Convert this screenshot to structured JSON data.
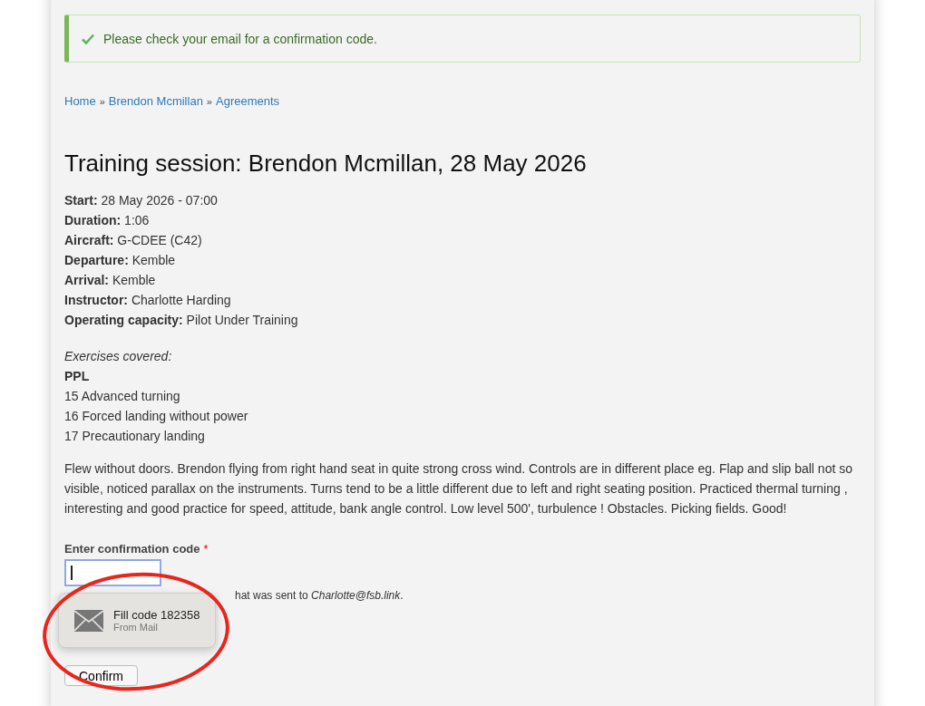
{
  "alert": {
    "kind": "success",
    "message": "Please check your email for a confirmation code."
  },
  "breadcrumb": [
    {
      "label": "Home"
    },
    {
      "label": "Brendon Mcmillan"
    },
    {
      "label": "Agreements"
    }
  ],
  "breadcrumb_separator": "»",
  "title": "Training session: Brendon Mcmillan, 28 May 2026",
  "details": [
    {
      "label": "Start:",
      "value": "28 May 2026 - 07:00"
    },
    {
      "label": "Duration:",
      "value": "1:06"
    },
    {
      "label": "Aircraft:",
      "value": "G-CDEE (C42)"
    },
    {
      "label": "Departure:",
      "value": "Kemble"
    },
    {
      "label": "Arrival:",
      "value": "Kemble"
    },
    {
      "label": "Instructor:",
      "value": "Charlotte Harding"
    },
    {
      "label": "Operating capacity:",
      "value": "Pilot Under Training"
    }
  ],
  "exercises": {
    "heading": "Exercises covered:",
    "syllabus": "PPL",
    "items": [
      "15 Advanced turning",
      "16 Forced landing without power",
      "17 Precautionary landing"
    ]
  },
  "notes": "Flew without doors. Brendon flying from right hand seat in quite strong cross wind. Controls are in different place eg. Flap and slip ball not so visible, noticed parallax on the instruments. Turns tend to be a little different due to left and right seating position. Practiced thermal turning , interesting and good practice for speed, attitude, bank angle control. Low level 500', turbulence ! Obstacles. Picking fields. Good!",
  "form": {
    "label": "Enter confirmation code",
    "required_mark": "*",
    "focused": true,
    "hint": "hat was sent to *Charlotte@fsb.link*.",
    "button": "Confirm"
  },
  "autofill": {
    "title": "Fill code 182358",
    "source": "From Mail"
  },
  "annotation": {
    "kind": "ellipse",
    "color": "#e8261c"
  }
}
